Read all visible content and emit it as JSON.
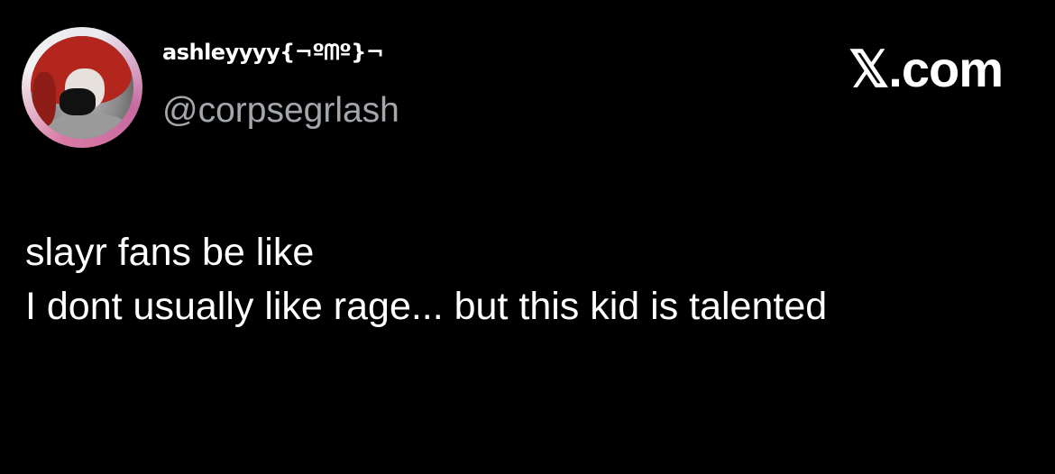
{
  "tweet": {
    "author": {
      "display_name": "ashleyyyy{¬ºᗰº}¬",
      "handle": "@corpsegrlash"
    },
    "brand": "𝕏.com",
    "text_lines": [
      "slayr fans be like",
      "I dont usually like rage... but this kid is talented"
    ]
  },
  "colors": {
    "background": "#000000",
    "text": "#ffffff",
    "secondary_text": "#a3a7ab"
  }
}
